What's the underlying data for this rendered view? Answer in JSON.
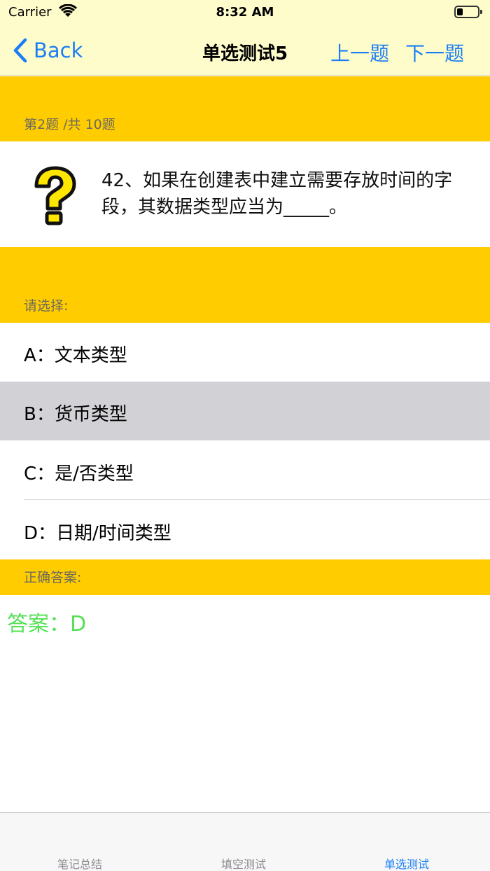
{
  "status_bar": {
    "carrier": "Carrier",
    "time": "8:32 AM"
  },
  "nav": {
    "back_label": "Back",
    "title": "单选测试5",
    "prev_label": "上一题",
    "next_label": "下一题"
  },
  "question": {
    "progress": "第2题 /共 10题",
    "icon": "question-mark-icon",
    "text": "42、如果在创建表中建立需要存放时间的字段，其数据类型应当为_____。"
  },
  "options_header": "请选择:",
  "options": [
    {
      "label": "A：文本类型"
    },
    {
      "label": "B：货币类型"
    },
    {
      "label": "C：是/否类型"
    },
    {
      "label": "D：日期/时间类型"
    }
  ],
  "selected_option": "B",
  "answer_header": "正确答案:",
  "answer_text": "答案：D",
  "tabs": [
    {
      "label": "笔记总结"
    },
    {
      "label": "填空测试"
    },
    {
      "label": "单选测试"
    }
  ],
  "active_tab": "单选测试",
  "colors": {
    "accent": "#1a7ff5",
    "header_bg": "#ffcc00",
    "nav_bg": "#fffccc",
    "answer": "#55e055",
    "selected_row": "#d1d1d6"
  }
}
